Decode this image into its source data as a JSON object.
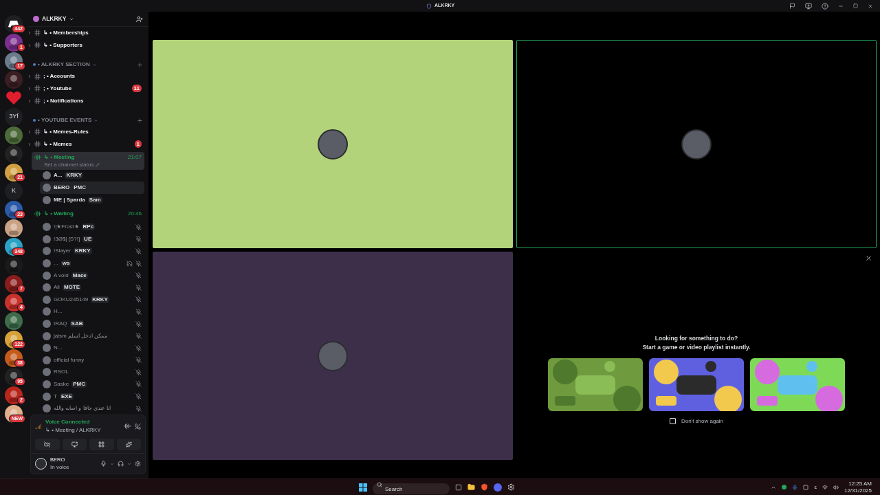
{
  "title_bar": {
    "title": "ALKRKY"
  },
  "servers": [
    {
      "kind": "logo",
      "badge": "442"
    },
    {
      "kind": "picture",
      "badge": "1"
    },
    {
      "kind": "picture",
      "badge": "17"
    },
    {
      "kind": "picture"
    },
    {
      "kind": "heart"
    },
    {
      "kind": "text",
      "label": "3Yf"
    },
    {
      "kind": "picture"
    },
    {
      "kind": "picture"
    },
    {
      "kind": "picture",
      "badge": "21"
    },
    {
      "kind": "text",
      "label": "K"
    },
    {
      "kind": "picture",
      "badge": "23"
    },
    {
      "kind": "picture"
    },
    {
      "kind": "picture",
      "badge": "348"
    },
    {
      "kind": "picture"
    },
    {
      "kind": "picture",
      "badge": "7"
    },
    {
      "kind": "picture",
      "badge": "4"
    },
    {
      "kind": "picture"
    },
    {
      "kind": "picture",
      "badge": "122"
    },
    {
      "kind": "picture",
      "badge": "38"
    },
    {
      "kind": "picture",
      "badge": "95"
    },
    {
      "kind": "picture",
      "badge": "2"
    },
    {
      "kind": "picture",
      "badge": "NEW"
    }
  ],
  "server_header": {
    "name": "ALKRKY"
  },
  "channels": [
    {
      "kind": "text",
      "name": "↳ • Memberships",
      "selected": false
    },
    {
      "kind": "text",
      "name": "↳ • Supporters",
      "selected": false
    },
    {
      "kind": "category",
      "name": "• ALKRKY SECTION",
      "selected": false
    },
    {
      "kind": "text",
      "name": "; • Accounts",
      "selected": false
    },
    {
      "kind": "text",
      "name": "; • Youtube",
      "badge": "11",
      "selected": false
    },
    {
      "kind": "text",
      "name": "; • Notifications",
      "selected": false
    },
    {
      "kind": "category",
      "name": "• YOUTUBE EVENTS",
      "selected": false
    },
    {
      "kind": "text",
      "name": "↳ • Memes-Rules",
      "selected": false
    },
    {
      "kind": "text",
      "name": "↳ • Memes",
      "badge": "1",
      "selected": false
    },
    {
      "kind": "voice",
      "name": "↳ • Meeting",
      "time": "21:07",
      "status": "Set a channel status",
      "selected": true,
      "members": [
        {
          "name": "A...",
          "tag": "KRKY",
          "muted": false,
          "deafened": false,
          "hovered": false
        },
        {
          "name": "BERO",
          "tag": "PMC",
          "muted": false,
          "deafened": false,
          "hovered": true
        },
        {
          "name": "ΜΕ | Sparda",
          "tag": "Sam",
          "muted": false,
          "deafened": false,
          "hovered": false
        }
      ]
    },
    {
      "kind": "voice",
      "name": "↳ • Waiting",
      "time": "20:46",
      "selected": false,
      "members": [
        {
          "name": "!|★Frost★",
          "tag": "RPc",
          "muted": true,
          "deafened": false,
          "hovered": false
        },
        {
          "name": "!3Ø$| [S?!]",
          "tag": "UE",
          "muted": true,
          "deafened": false,
          "hovered": false
        },
        {
          "name": "!Slayer",
          "tag": "KRKY",
          "muted": true,
          "deafened": false,
          "hovered": false
        },
        {
          "name": "...",
          "tag": "ws",
          "muted": true,
          "deafened": true,
          "hovered": false
        },
        {
          "name": "A void",
          "tag": "Mace",
          "muted": true,
          "deafened": false,
          "hovered": false
        },
        {
          "name": "Ali",
          "tag": "MOTE",
          "muted": true,
          "deafened": false,
          "hovered": false
        },
        {
          "name": "GOKU245149",
          "tag": "KRKY",
          "muted": true,
          "deafened": false,
          "hovered": false
        },
        {
          "name": "H...",
          "muted": true,
          "deafened": false,
          "hovered": false
        },
        {
          "name": "IRAQ",
          "tag": "SAB",
          "muted": true,
          "deafened": false,
          "hovered": false
        },
        {
          "name": "jaism ممكن ادخل اسلم",
          "muted": true,
          "deafened": false,
          "hovered": false
        },
        {
          "name": "N...",
          "muted": true,
          "deafened": false,
          "hovered": false
        },
        {
          "name": "official funny",
          "muted": true,
          "deafened": false,
          "hovered": false
        },
        {
          "name": "RSOL",
          "muted": true,
          "deafened": false,
          "hovered": false
        },
        {
          "name": "Saske",
          "tag": "PMC",
          "muted": true,
          "deafened": false,
          "hovered": false
        },
        {
          "name": "T",
          "tag": "EXE",
          "muted": true,
          "deafened": false,
          "hovered": false
        },
        {
          "name": "انا عندي جاقا و اصابه والله",
          "muted": true,
          "deafened": false,
          "hovered": false
        }
      ]
    }
  ],
  "voice_panel": {
    "status": "Voice Connected",
    "channel": "↳ • Meeting / ALKRKY"
  },
  "user_panel": {
    "name": "BERO",
    "status": "In voice"
  },
  "tiles": [
    {
      "color": "#b3d37a",
      "speaking": false
    },
    {
      "color": "#000000",
      "speaking": true
    },
    {
      "color": "#3d2f49",
      "speaking": false
    }
  ],
  "activity": {
    "heading": "Looking for something to do?",
    "subheading": "Start a game or video playlist instantly.",
    "games": [
      {
        "kind": "picture"
      },
      {
        "kind": "picture"
      },
      {
        "kind": "picture"
      }
    ],
    "dont_show_again": {
      "label": "Don't show again",
      "checked": false
    }
  },
  "taskbar": {
    "search_placeholder": "Search",
    "input_indicator": "ε",
    "time": "12:25 AM",
    "date": "12/31/2025"
  }
}
